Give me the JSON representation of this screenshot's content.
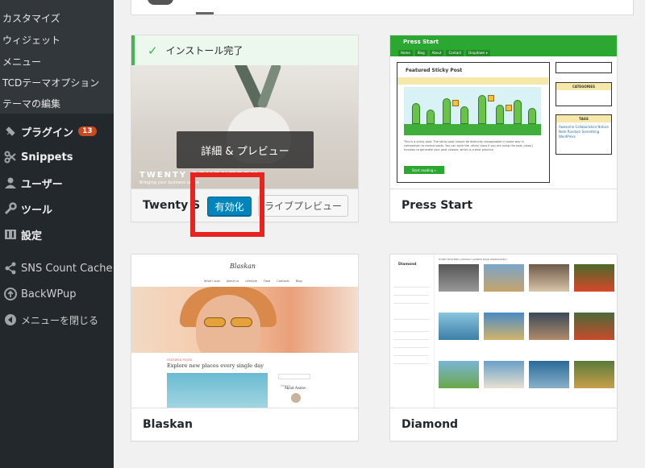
{
  "sidebar": {
    "submenu": [
      "カスタマイズ",
      "ウィジェット",
      "メニュー",
      "TCDテーマオプション",
      "テーマの編集"
    ],
    "items": [
      {
        "label": "プラグイン",
        "icon": "plugin-icon",
        "badge": "13"
      },
      {
        "label": "Snippets",
        "icon": "scissors-icon"
      },
      {
        "label": "ユーザー",
        "icon": "user-icon"
      },
      {
        "label": "ツール",
        "icon": "wrench-icon"
      },
      {
        "label": "設定",
        "icon": "settings-icon"
      },
      {
        "label": "SNS Count Cache",
        "icon": "share-icon"
      },
      {
        "label": "BackWPup",
        "icon": "backwpup-icon"
      },
      {
        "label": "メニューを閉じる",
        "icon": "collapse-icon"
      }
    ]
  },
  "themes": {
    "twenty": {
      "notice": "インストール完了",
      "details_button": "詳細 & プレビュー",
      "name": "Twenty S",
      "activate": "有効化",
      "live_preview": "ライブプレビュー",
      "shot_title": "TWENTY SEVENTEEN",
      "shot_sub": "Bringing your business online"
    },
    "press": {
      "name": "Press Start",
      "shot_title": "Press Start",
      "nav": [
        "Home",
        "Blog",
        "About",
        "Contact",
        "Dropdown ▾"
      ],
      "post_title": "Featured Sticky Post",
      "post_text": "This is a sticky post. The sticky post should be distinctly recognizable in some way in comparison to normal posts. You can style the .sticky class if you are using the post_class() function to generate your post classes, which is a best practice.",
      "post_button": "Start reading »",
      "widgets": [
        "CATEGORIES",
        "TAGS"
      ],
      "tags_text": "Awesome Collaboration Nature Note Random Something WordPress"
    },
    "blaskan": {
      "name": "Blaskan",
      "logo": "Blaskan",
      "menu": [
        "What I love",
        "About us",
        "Lifestyle",
        "Food",
        "Contacts",
        "Blog"
      ],
      "post_category": "FEATURED POSTS",
      "post_heading": "Explore new places every single day",
      "search": "Search...",
      "about": "About Avalon"
    },
    "diamond": {
      "name": "Diamond",
      "shot_title": "Diamond",
      "nav": "HOME  FEATURED  CONTACT  SAMPLE PAGE  DROPDOWN ▾"
    }
  },
  "colors": {
    "sidebar_bg": "#23282d",
    "notice_green": "#46b450",
    "activate_blue": "#0085ba",
    "highlight_red": "#e8231f",
    "badge_orange": "#ca4a1f"
  }
}
